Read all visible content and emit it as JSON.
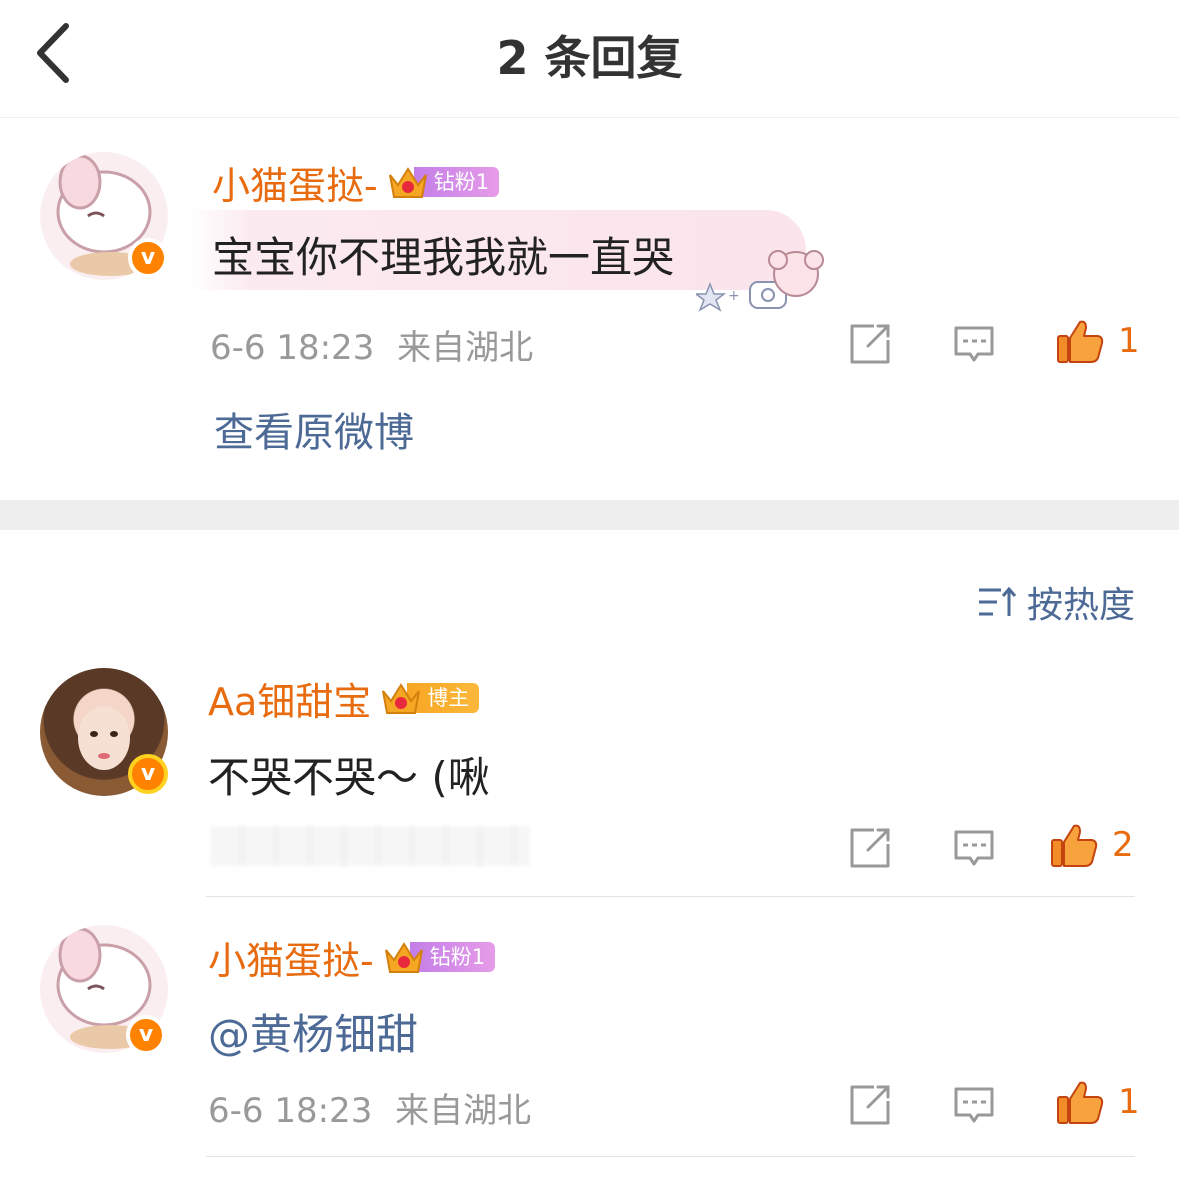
{
  "header": {
    "title": "2 条回复",
    "back_icon": "chevron-left-icon"
  },
  "main_comment": {
    "username": "小猫蛋挞-",
    "badge": "钻粉1",
    "badge_level": "6",
    "text": "宝宝你不理我我就一直哭",
    "time": "6-6 18:23",
    "location": "来自湖北",
    "likes": "1",
    "view_original": "查看原微博"
  },
  "sort": {
    "label": "按热度"
  },
  "replies": [
    {
      "username": "Aa钿甜宝",
      "badge": "博主",
      "badge_level": "7",
      "text": "不哭不哭～ (啾",
      "likes": "2"
    },
    {
      "username": "小猫蛋挞-",
      "badge": "钻粉1",
      "badge_level": "6",
      "text": "@黄杨钿甜",
      "time": "6-6 18:23",
      "location": "来自湖北",
      "likes": "1"
    }
  ],
  "colors": {
    "username": "#e86b0f",
    "link": "#4d6a96",
    "meta": "#999999",
    "fan_badge": "#c37ee8",
    "host_badge": "#f7a623"
  }
}
